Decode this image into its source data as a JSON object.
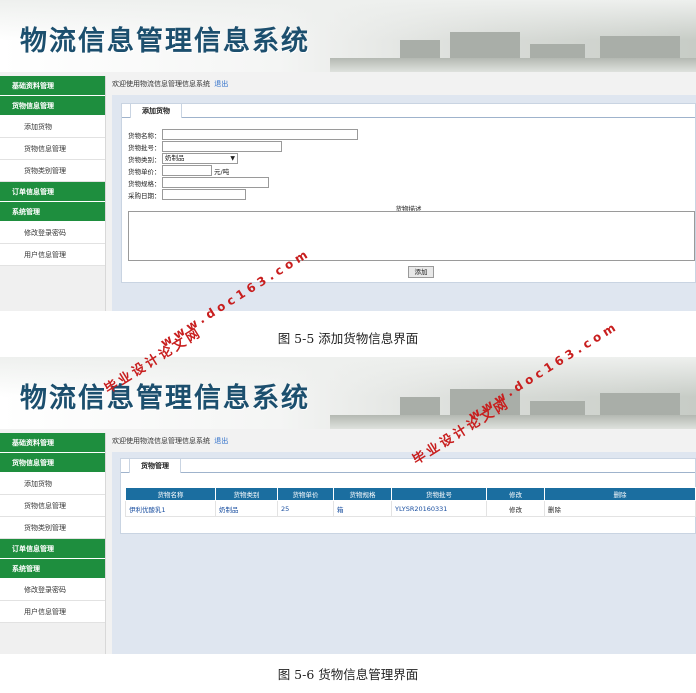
{
  "system_title": "物流信息管理信息系统",
  "sidebar": {
    "groups": [
      {
        "label": "基础资料管理"
      },
      {
        "label": "货物信息管理",
        "items": [
          "添加货物",
          "货物信息管理",
          "货物类别管理"
        ]
      },
      {
        "label": "订单信息管理"
      },
      {
        "label": "系统管理",
        "items": [
          "修改登录密码",
          "用户信息管理"
        ]
      }
    ]
  },
  "welcome": {
    "text": "欢迎使用物流信息管理信息系统",
    "logout": "退出"
  },
  "add_form": {
    "tab": "添加货物",
    "name_label": "货物名称：",
    "batch_label": "货物批号：",
    "category_label": "货物类别：",
    "category_value": "奶制品",
    "price_label": "货物单价：",
    "price_unit": "元/吨",
    "spec_label": "货物规格：",
    "date_label": "采购日期：",
    "desc_label": "货物描述",
    "submit": "添加"
  },
  "list_page": {
    "tab": "货物管理",
    "columns": [
      "货物名称",
      "货物类别",
      "货物单价",
      "货物规格",
      "货物批号",
      "修改",
      "删除"
    ],
    "rows": [
      {
        "name": "伊利优酸乳1",
        "category": "奶制品",
        "price": "25",
        "spec": "箱",
        "batch": "YLYSR20160331",
        "edit": "修改",
        "delete": "删除"
      }
    ]
  },
  "captions": {
    "fig1": "图 5-5 添加货物信息界面",
    "fig2": "图 5-6 货物信息管理界面"
  },
  "watermark": {
    "cn": "毕业设计论文网",
    "url": "www.doc163.com"
  },
  "colors": {
    "nav_green": "#1e8e3e",
    "header_blue": "#1b6ea0",
    "watermark_red": "#c81e1e",
    "title_blue": "#1c4f6e"
  }
}
